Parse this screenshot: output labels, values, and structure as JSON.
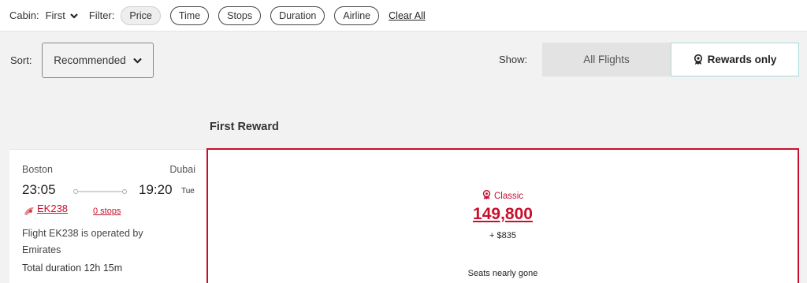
{
  "filter_bar": {
    "cabin_label": "Cabin:",
    "cabin_value": "First",
    "filter_label": "Filter:",
    "filters": [
      "Price",
      "Time",
      "Stops",
      "Duration",
      "Airline"
    ],
    "active_filter": "Price",
    "clear_all": "Clear All"
  },
  "sort_bar": {
    "sort_label": "Sort:",
    "sort_value": "Recommended",
    "show_label": "Show:",
    "show_options": [
      "All Flights",
      "Rewards only"
    ],
    "selected_show": "Rewards only"
  },
  "section_title": "First Reward",
  "flight": {
    "origin": "Boston",
    "destination": "Dubai",
    "departure_time": "23:05",
    "arrival_time": "19:20",
    "arrival_day": "Tue",
    "flight_number": "EK238",
    "stops": "0 stops",
    "operated_by": "Flight EK238 is operated by Emirates",
    "total_duration": "Total duration 12h 15m"
  },
  "fare": {
    "type": "Classic",
    "points": "149,800",
    "taxes": "+ $835",
    "availability": "Seats nearly gone"
  },
  "colors": {
    "brand_red": "#c8102e",
    "selected_toggle_border": "#a9dada",
    "page_background": "#f2f2f2"
  },
  "icons": {
    "cabin_dropdown": "chevron-down-icon",
    "sort_dropdown": "chevron-down-icon",
    "rewards": "reward-badge-icon",
    "airline": "emirates-logo-icon",
    "route_line": "flight-path-icon"
  }
}
